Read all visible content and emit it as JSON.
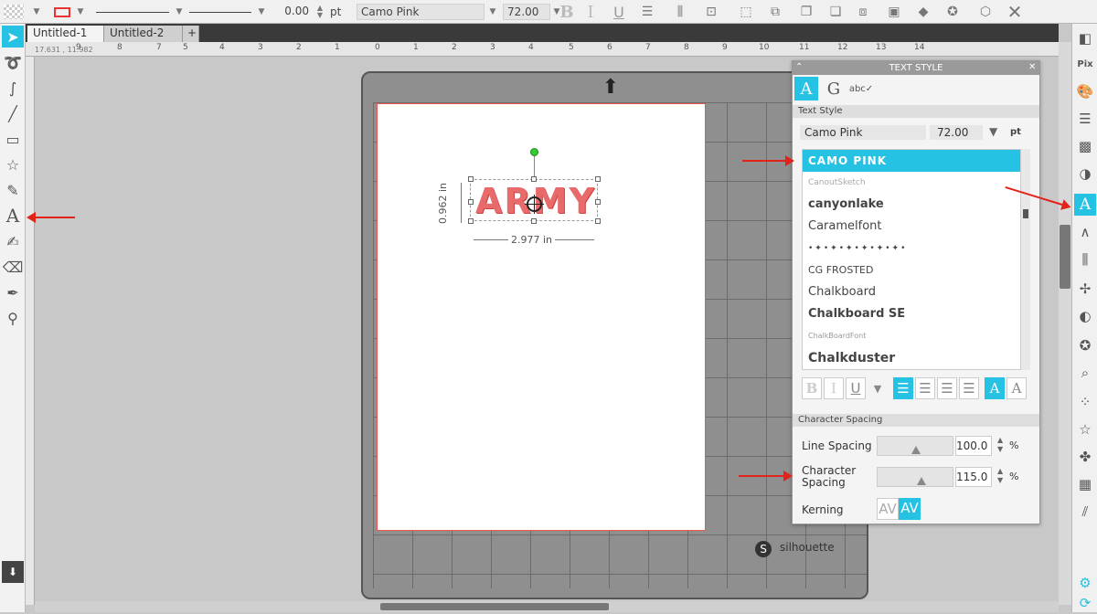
{
  "toolbar": {
    "line_width_value": "0.00",
    "line_width_unit": "pt",
    "font_name": "Camo Pink",
    "font_size": "72.00",
    "bold": "B",
    "italic": "I",
    "underline": "U"
  },
  "tabs": [
    {
      "label": "Untitled-1"
    },
    {
      "label": "Untitled-2"
    },
    {
      "label": "+"
    }
  ],
  "ruler": {
    "coords": "17.631 , 11.982",
    "h_ticks": [
      "9",
      "8",
      "7",
      "6",
      "5",
      "4",
      "3",
      "2",
      "1",
      "0",
      "1",
      "2",
      "3",
      "4",
      "5",
      "6",
      "7",
      "8",
      "9",
      "10",
      "11",
      "12",
      "13",
      "14"
    ]
  },
  "canvas": {
    "text_object": "ARMY",
    "height_label": "0.962 in",
    "width_label": "2.977 in",
    "brand": "silhouette"
  },
  "panel": {
    "title": "TEXT STYLE",
    "section_text_style": "Text Style",
    "font_field": "Camo Pink",
    "size_field": "72.00",
    "size_unit": "pt",
    "fonts": [
      "CAMO PINK",
      "CanoutSketch",
      "canyonlake",
      "Caramelfont",
      "•✦•✦•✦•✦•✦•✦•",
      "CG FROSTED",
      "Chalkboard",
      "Chalkboard SE",
      "ChalkBoardFont",
      "Chalkduster"
    ],
    "fmt_bold": "B",
    "fmt_italic": "I",
    "fmt_underline": "U",
    "section_spacing": "Character Spacing",
    "line_spacing_label": "Line Spacing",
    "line_spacing_value": "100.0",
    "char_spacing_label_1": "Character",
    "char_spacing_label_2": "Spacing",
    "char_spacing_value": "115.0",
    "percent": "%",
    "kerning_label": "Kerning",
    "kerning_off": "AV",
    "kerning_on": "AV"
  },
  "colors": {
    "accent": "#26c2e3",
    "arrow": "#e2231a",
    "text_fill": "#e86a6a"
  }
}
